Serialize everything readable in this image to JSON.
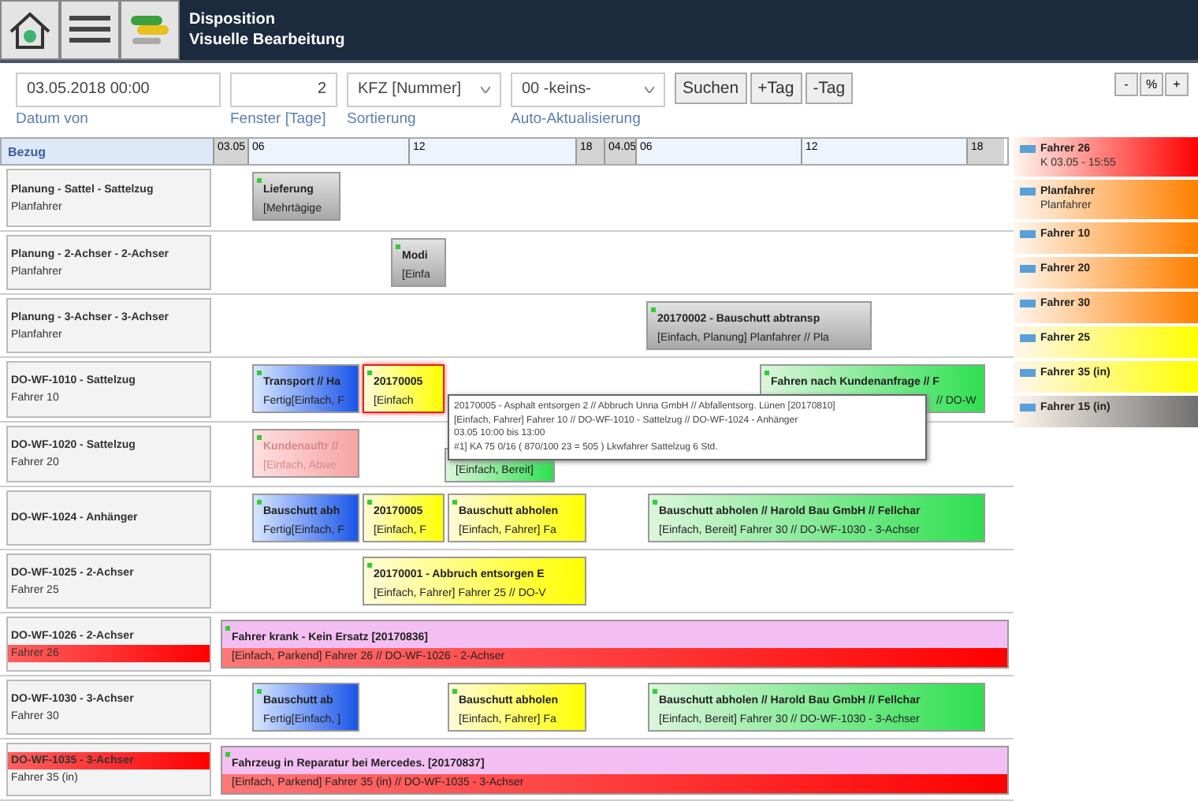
{
  "window": {
    "title": "Disposition",
    "subtitle": "Visuelle Bearbeitung"
  },
  "toolbar": {
    "fields": [
      {
        "kind": "input",
        "value": "03.05.2018 00:00",
        "label": "Datum von"
      },
      {
        "kind": "number",
        "value": "2",
        "label": "Fenster [Tage]"
      },
      {
        "kind": "select",
        "value": "KFZ [Nummer]",
        "label": "Sortierung"
      },
      {
        "kind": "select",
        "value": "00 -keins-",
        "label": "Auto-Aktualisierung"
      }
    ],
    "buttons": [
      "Suchen",
      "+Tag",
      "-Tag"
    ],
    "zoom_buttons": [
      "-",
      "%",
      "+"
    ]
  },
  "timeline": {
    "column_label": "Bezug",
    "header": [
      {
        "kind": "date",
        "label": "03.05"
      },
      {
        "kind": "hour",
        "label": "06"
      },
      {
        "kind": "hour",
        "label": "12"
      },
      {
        "kind": "date",
        "label": "18"
      },
      {
        "kind": "date",
        "label": "04.05"
      },
      {
        "kind": "hour",
        "label": "06"
      },
      {
        "kind": "hour",
        "label": "12"
      },
      {
        "kind": "date",
        "label": "18"
      }
    ]
  },
  "rows": [
    {
      "title": {
        "text": "Planung - Sattel - Sattelzug",
        "alert": false
      },
      "subtitle": {
        "text": "Planfahrer",
        "alert": false
      },
      "bars": [
        {
          "kind": "planned",
          "selected": false,
          "line1": "Lieferung",
          "line2": "[Mehrtägige"
        }
      ]
    },
    {
      "title": {
        "text": "Planung - 2-Achser - 2-Achser",
        "alert": false
      },
      "subtitle": {
        "text": "Planfahrer",
        "alert": false
      },
      "bars": [
        {
          "kind": "planned",
          "selected": false,
          "line1": "Modi",
          "line2": "[Einfa"
        }
      ]
    },
    {
      "title": {
        "text": "Planung - 3-Achser - 3-Achser",
        "alert": false
      },
      "subtitle": {
        "text": "Planfahrer",
        "alert": false
      },
      "bars": [
        {
          "kind": "planned",
          "selected": false,
          "line1": "20170002 - Bauschutt abtransp",
          "line2": "[Einfach, Planung] Planfahrer // Pla"
        }
      ]
    },
    {
      "title": {
        "text": "DO-WF-1010 - Sattelzug",
        "alert": false
      },
      "subtitle": {
        "text": "Fahrer 10",
        "alert": false
      },
      "bars": [
        {
          "kind": "done",
          "selected": false,
          "line1": "Transport // Ha",
          "line2": "Fertig[Einfach, F"
        },
        {
          "kind": "driver",
          "selected": true,
          "line1": "20170005",
          "line2": "[Einfach"
        },
        {
          "kind": "ready",
          "selected": false,
          "line1": "Fahren nach Kundenanfrage // F",
          "line2": "// DO-W"
        }
      ]
    },
    {
      "title": {
        "text": "DO-WF-1020 - Sattelzug",
        "alert": false
      },
      "subtitle": {
        "text": "Fahrer 20",
        "alert": false
      },
      "bars": [
        {
          "kind": "customer",
          "selected": false,
          "line1": "Kundenauftr //",
          "line2": "[Einfach, Abwe"
        },
        {
          "kind": "ready",
          "selected": false,
          "line2": "[Einfach, Bereit]"
        }
      ]
    },
    {
      "title": {
        "text": "DO-WF-1024 - Anhänger",
        "alert": false
      },
      "bars": [
        {
          "kind": "done",
          "selected": false,
          "line1": "Bauschutt abh",
          "line2": "Fertig[Einfach, F"
        },
        {
          "kind": "driver",
          "selected": false,
          "line1": "20170005",
          "line2": "[Einfach, F"
        },
        {
          "kind": "driver",
          "selected": false,
          "line1": "Bauschutt abholen",
          "line2": "[Einfach, Fahrer] Fa"
        },
        {
          "kind": "ready",
          "selected": false,
          "line1": "Bauschutt abholen // Harold Bau GmbH // Fellchar",
          "line2": "[Einfach, Bereit] Fahrer 30 // DO-WF-1030 - 3-Achser"
        }
      ]
    },
    {
      "title": {
        "text": "DO-WF-1025 - 2-Achser",
        "alert": false
      },
      "subtitle": {
        "text": "Fahrer 25",
        "alert": false
      },
      "bars": [
        {
          "kind": "driver",
          "selected": false,
          "line1": "20170001 - Abbruch entsorgen E",
          "line2": "[Einfach, Fahrer] Fahrer 25 // DO-V"
        }
      ]
    },
    {
      "title": {
        "text": "DO-WF-1026 - 2-Achser",
        "alert": false
      },
      "subtitle": {
        "text": "Fahrer 26",
        "alert": true
      },
      "bars": [
        {
          "kind": "parked",
          "selected": false,
          "line1": "Fahrer krank - Kein Ersatz [20170836]",
          "line2": "[Einfach, Parkend] Fahrer 26 // DO-WF-1026 - 2-Achser"
        }
      ]
    },
    {
      "title": {
        "text": "DO-WF-1030 - 3-Achser",
        "alert": false
      },
      "subtitle": {
        "text": "Fahrer 30",
        "alert": false
      },
      "bars": [
        {
          "kind": "done",
          "selected": false,
          "line1": "Bauschutt ab",
          "line2": "Fertig[Einfach, ]"
        },
        {
          "kind": "driver",
          "selected": false,
          "line1": "Bauschutt abholen",
          "line2": "[Einfach, Fahrer] Fa"
        },
        {
          "kind": "ready",
          "selected": false,
          "line1": "Bauschutt abholen // Harold Bau GmbH // Fellchar",
          "line2": "[Einfach, Bereit] Fahrer 30 // DO-WF-1030 - 3-Achser"
        }
      ]
    },
    {
      "title": {
        "text": "DO-WF-1035 - 3-Achser",
        "alert": true
      },
      "subtitle": {
        "text": "Fahrer 35 (in)",
        "alert": false
      },
      "bars": [
        {
          "kind": "parked",
          "selected": false,
          "line1": "Fahrzeug in Reparatur bei Mercedes. [20170837]",
          "line2": "[Einfach, Parkend] Fahrer 35 (in) // DO-WF-1035 - 3-Achser"
        }
      ]
    }
  ],
  "tooltip": {
    "lines": [
      "20170005 - Asphalt entsorgen 2 // Abbruch Unna GmbH // Abfallentsorg. Lünen [20170810]",
      "[Einfach, Fahrer] Fahrer 10 // DO-WF-1010 - Sattelzug // DO-WF-1024 - Anhänger",
      "03.05 10:00 bis 13:00",
      "#1] KA 75 0/16 ( 870/100 23 = 505 ) Lkwfahrer Sattelzug 6 Std."
    ]
  },
  "drivers": [
    {
      "name": "Fahrer 26",
      "detail": "K 03.05 - 15:55",
      "color": "#ff0000"
    },
    {
      "name": "Planfahrer",
      "detail": "Planfahrer",
      "color": "#ff8000"
    },
    {
      "name": "Fahrer 10",
      "color": "#ff8000"
    },
    {
      "name": "Fahrer 20",
      "color": "#ff8000"
    },
    {
      "name": "Fahrer 30",
      "color": "#ff8000"
    },
    {
      "name": "Fahrer 25",
      "color": "#ffff00"
    },
    {
      "name": "Fahrer 35 (in)",
      "color": "#ffff00"
    },
    {
      "name": "Fahrer 15 (in)",
      "color": "#707070"
    }
  ]
}
